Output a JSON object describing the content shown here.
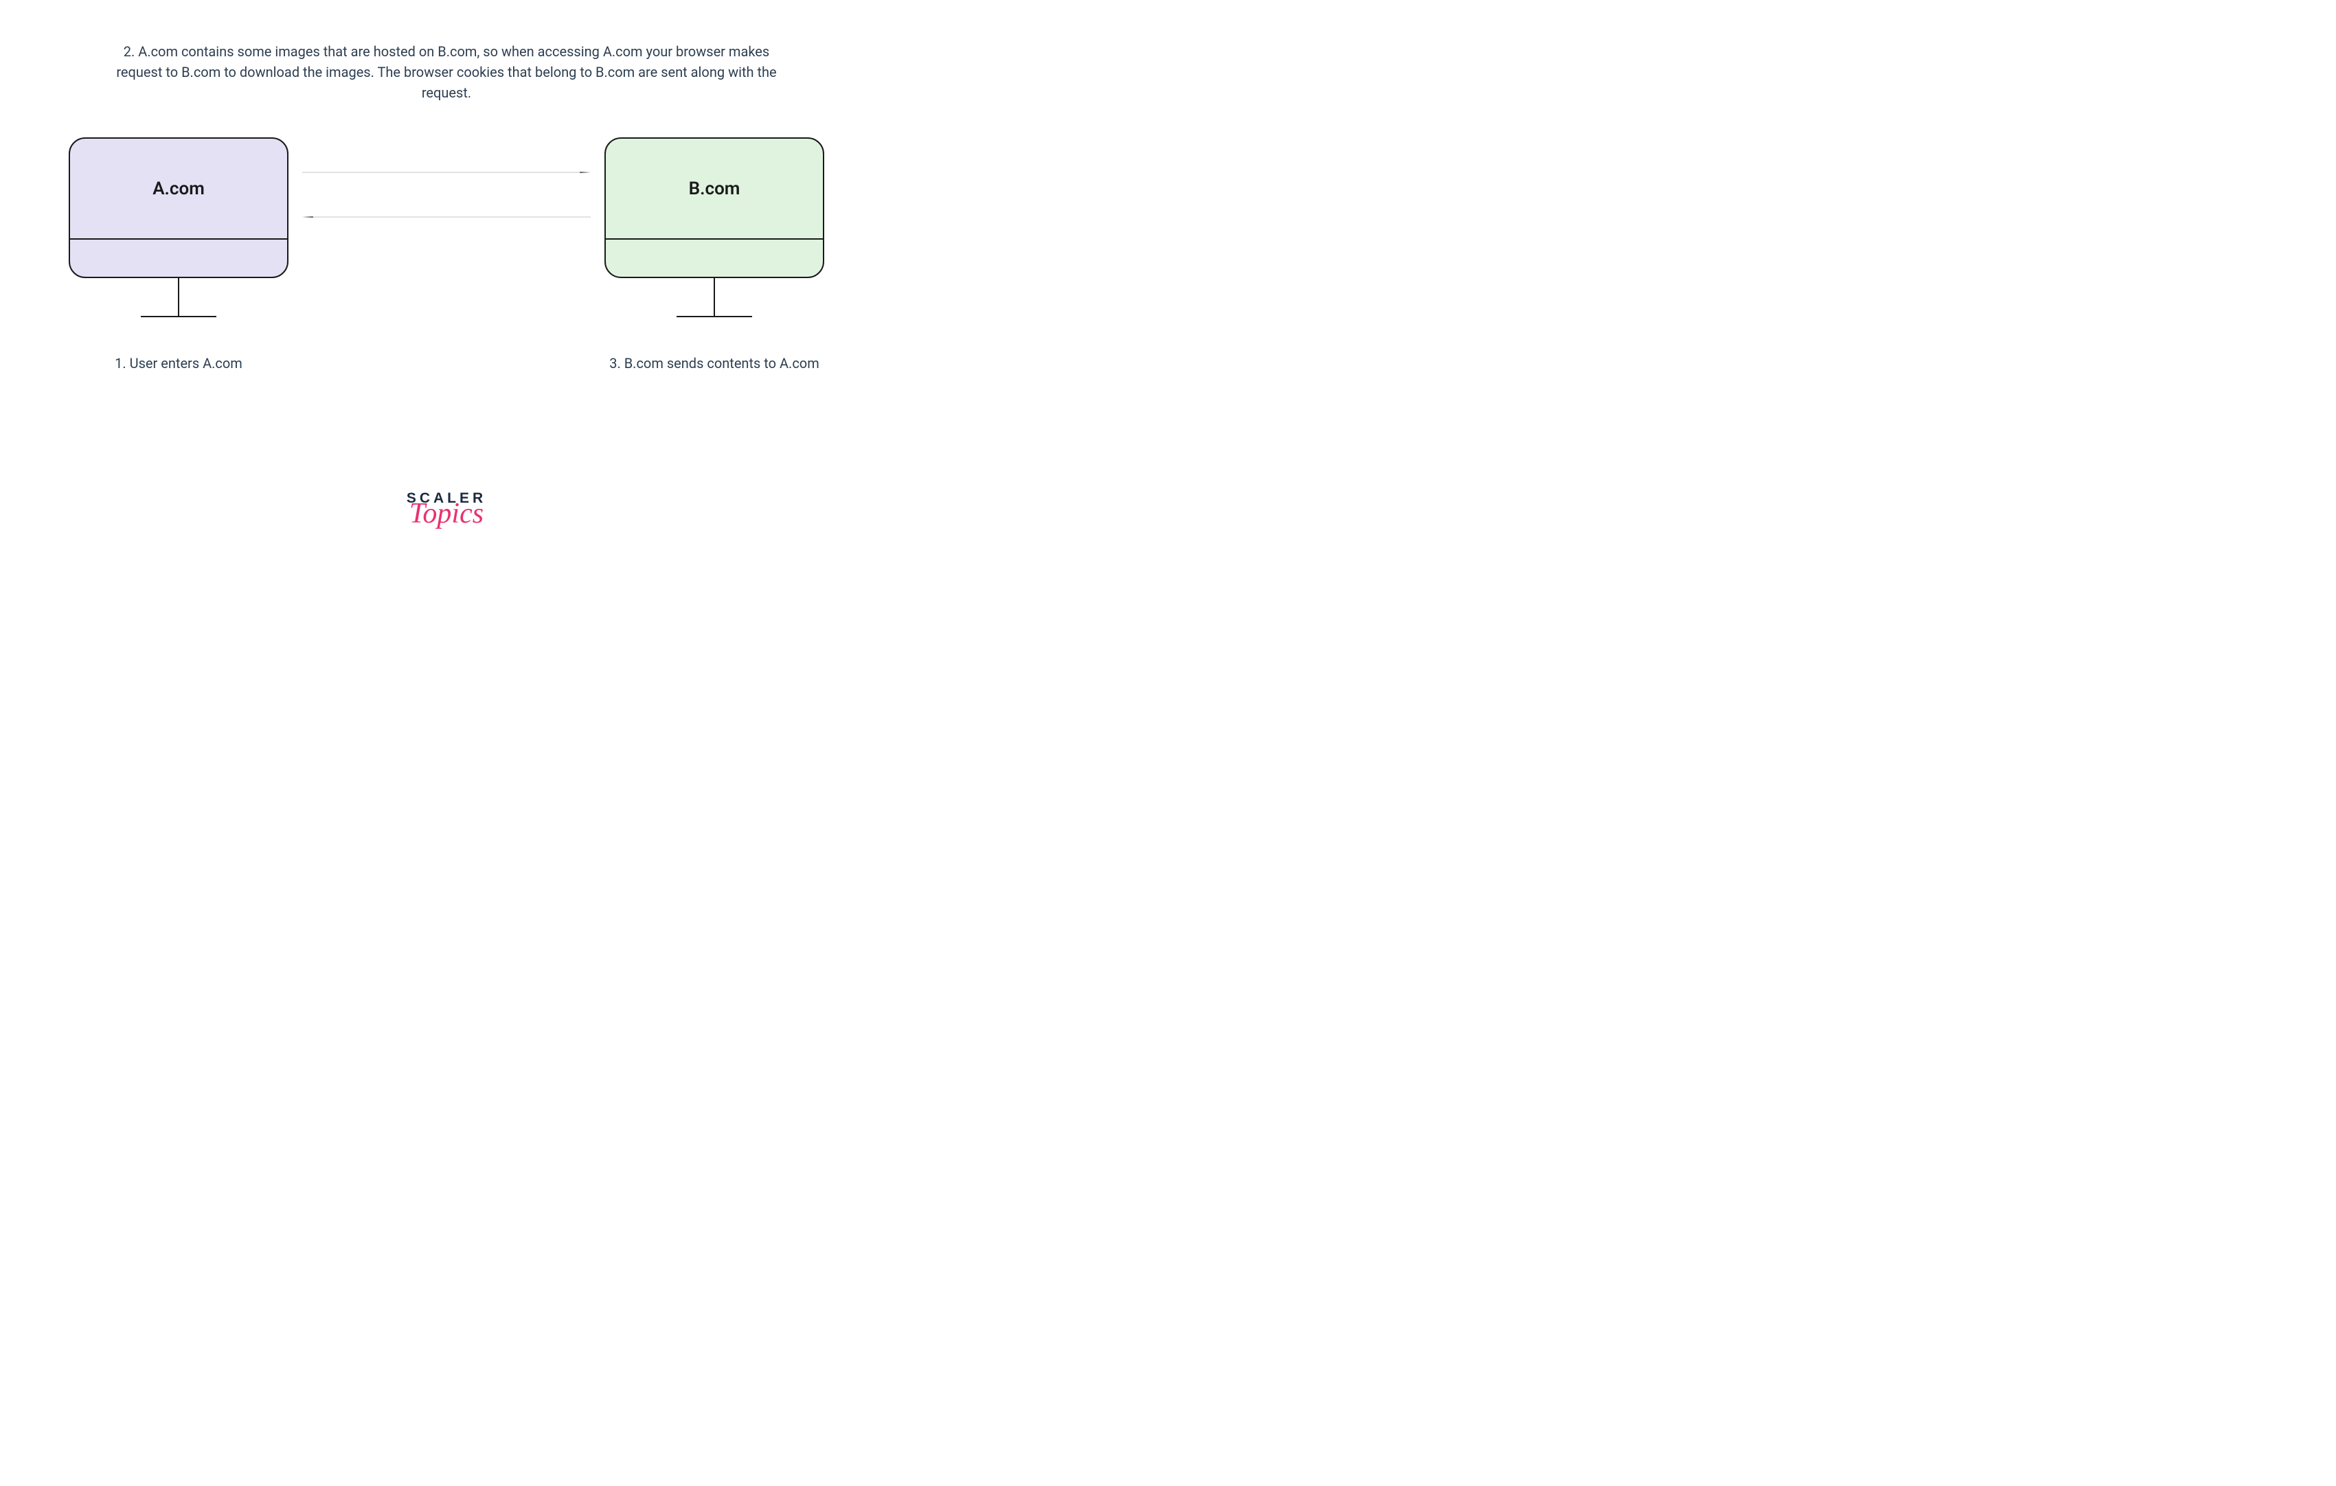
{
  "caption_top": "2. A.com contains some images that are hosted on B.com, so when accessing A.com your browser makes request to B.com to download the images. The browser cookies that belong to B.com are sent along with the request.",
  "computer_a": {
    "label": "A.com",
    "caption": "1. User enters A.com",
    "fill_color": "#e4e1f5"
  },
  "computer_b": {
    "label": "B.com",
    "caption": "3. B.com sends contents to A.com",
    "fill_color": "#dff3df"
  },
  "logo": {
    "line1": "SCALER",
    "line2": "Topics"
  },
  "colors": {
    "text_dark": "#2d3e50",
    "stroke": "#1a1a1a",
    "accent": "#e9316f"
  }
}
